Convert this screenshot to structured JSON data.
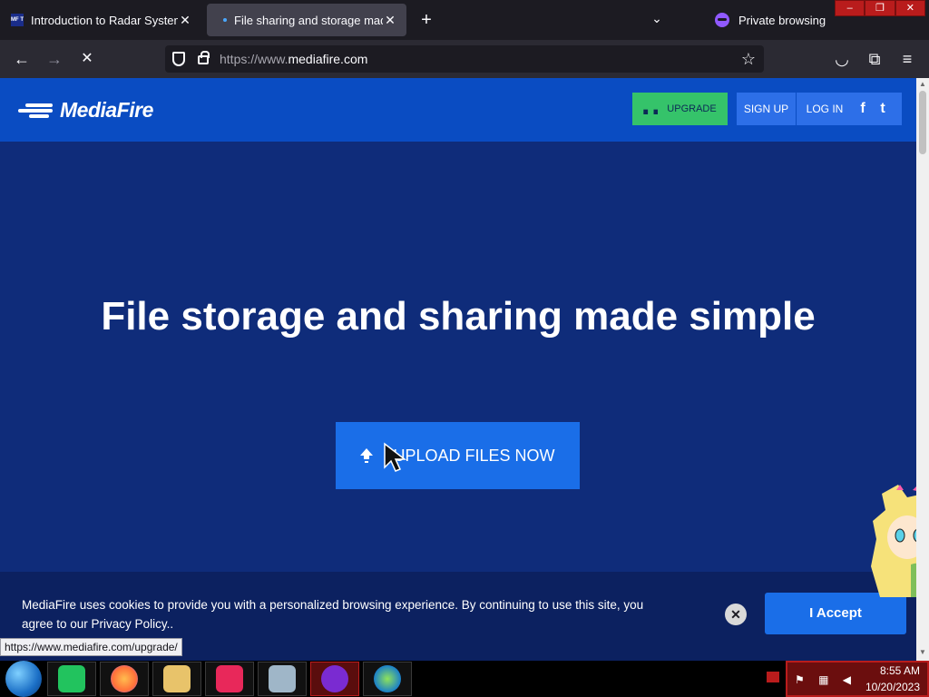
{
  "browser": {
    "tabs": [
      {
        "title": "Introduction to Radar Systems -",
        "favicon": "MF T"
      },
      {
        "title": "File sharing and storage made s",
        "active": true
      }
    ],
    "new_tab_label": "+",
    "private_label": "Private browsing",
    "url_prefix": "https://www.",
    "url_domain": "mediafire.com",
    "status_link": "https://www.mediafire.com/upgrade/"
  },
  "site": {
    "logo_text": "MediaFire",
    "upgrade_label": "UPGRADE",
    "signup_label": "SIGN UP",
    "login_label": "LOG IN",
    "facebook_glyph": "f",
    "twitter_glyph": "t",
    "hero_title": "File storage and sharing made simple",
    "upload_label": "UPLOAD FILES NOW"
  },
  "cookie_banner": {
    "message": "MediaFire uses cookies to provide you with a personalized browsing experience. By continuing to use this site, you agree to our Privacy Policy..",
    "close_glyph": "✕",
    "accept_label": "I Accept"
  },
  "taskbar": {
    "time": "8:55 AM",
    "date": "10/20/2023"
  },
  "colors": {
    "header_blue": "#0a4cc2",
    "page_navy": "#0f2c7a",
    "upgrade_green": "#35c36a",
    "button_blue": "#1a6ee8"
  }
}
